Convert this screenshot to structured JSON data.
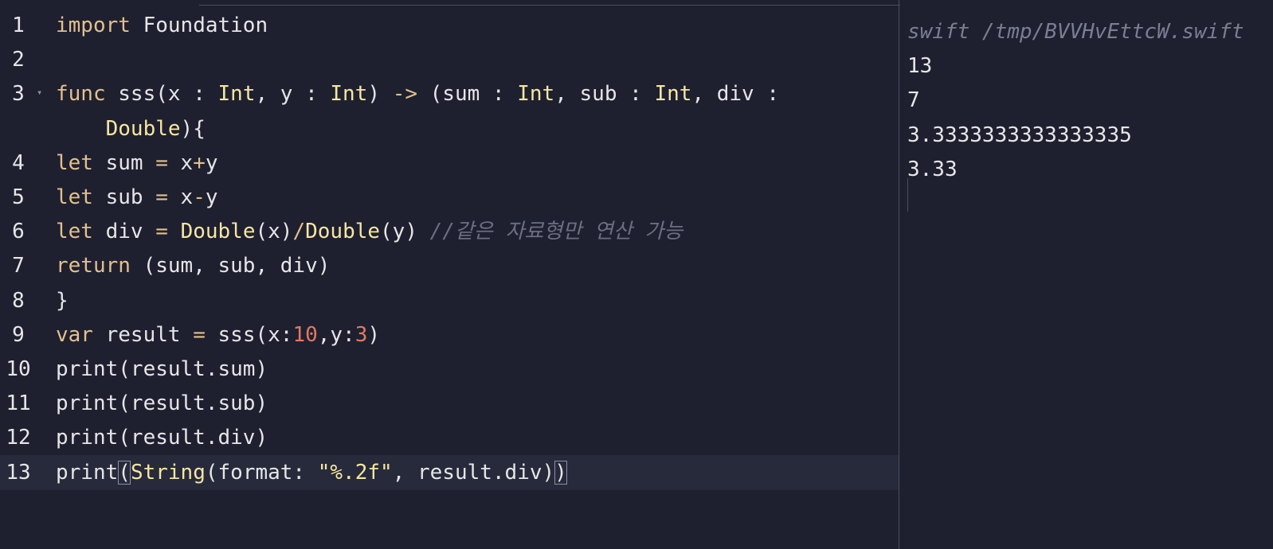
{
  "editor": {
    "lines": [
      {
        "num": "1",
        "tokens": [
          {
            "t": "import",
            "c": "kw"
          },
          {
            "t": " Foundation",
            "c": ""
          }
        ]
      },
      {
        "num": "2",
        "tokens": []
      },
      {
        "num": "3",
        "fold": true,
        "tokens": [
          {
            "t": "func",
            "c": "kw"
          },
          {
            "t": " sss(x : ",
            "c": ""
          },
          {
            "t": "Int",
            "c": "ty"
          },
          {
            "t": ", y : ",
            "c": ""
          },
          {
            "t": "Int",
            "c": "ty"
          },
          {
            "t": ") ",
            "c": ""
          },
          {
            "t": "->",
            "c": "op"
          },
          {
            "t": " (sum : ",
            "c": ""
          },
          {
            "t": "Int",
            "c": "ty"
          },
          {
            "t": ", sub : ",
            "c": ""
          },
          {
            "t": "Int",
            "c": "ty"
          },
          {
            "t": ", div :",
            "c": ""
          }
        ]
      },
      {
        "num": "",
        "tokens": [
          {
            "t": "    ",
            "c": ""
          },
          {
            "t": "Double",
            "c": "ty"
          },
          {
            "t": "){",
            "c": ""
          }
        ]
      },
      {
        "num": "4",
        "tokens": [
          {
            "t": "let",
            "c": "kw"
          },
          {
            "t": " sum ",
            "c": ""
          },
          {
            "t": "=",
            "c": "op"
          },
          {
            "t": " x",
            "c": ""
          },
          {
            "t": "+",
            "c": "op"
          },
          {
            "t": "y",
            "c": ""
          }
        ]
      },
      {
        "num": "5",
        "tokens": [
          {
            "t": "let",
            "c": "kw"
          },
          {
            "t": " sub ",
            "c": ""
          },
          {
            "t": "=",
            "c": "op"
          },
          {
            "t": " x",
            "c": ""
          },
          {
            "t": "-",
            "c": "op"
          },
          {
            "t": "y",
            "c": ""
          }
        ]
      },
      {
        "num": "6",
        "tokens": [
          {
            "t": "let",
            "c": "kw"
          },
          {
            "t": " div ",
            "c": ""
          },
          {
            "t": "=",
            "c": "op"
          },
          {
            "t": " ",
            "c": ""
          },
          {
            "t": "Double",
            "c": "ty"
          },
          {
            "t": "(x)",
            "c": ""
          },
          {
            "t": "/",
            "c": "op"
          },
          {
            "t": "Double",
            "c": "ty"
          },
          {
            "t": "(y) ",
            "c": ""
          },
          {
            "t": "//같은 자료형만 연산 가능",
            "c": "cm"
          }
        ]
      },
      {
        "num": "7",
        "tokens": [
          {
            "t": "return",
            "c": "kw"
          },
          {
            "t": " (sum, sub, div)",
            "c": ""
          }
        ]
      },
      {
        "num": "8",
        "tokens": [
          {
            "t": "}",
            "c": ""
          }
        ]
      },
      {
        "num": "9",
        "tokens": [
          {
            "t": "var",
            "c": "kw"
          },
          {
            "t": " result ",
            "c": ""
          },
          {
            "t": "=",
            "c": "op"
          },
          {
            "t": " sss(x:",
            "c": ""
          },
          {
            "t": "10",
            "c": "num"
          },
          {
            "t": ",y:",
            "c": ""
          },
          {
            "t": "3",
            "c": "num"
          },
          {
            "t": ")",
            "c": ""
          }
        ]
      },
      {
        "num": "10",
        "tokens": [
          {
            "t": "print(result.sum)",
            "c": ""
          }
        ]
      },
      {
        "num": "11",
        "tokens": [
          {
            "t": "print(result.sub)",
            "c": ""
          }
        ]
      },
      {
        "num": "12",
        "tokens": [
          {
            "t": "print(result.div)",
            "c": ""
          }
        ]
      },
      {
        "num": "13",
        "current": true,
        "tokens": [
          {
            "t": "print",
            "c": ""
          },
          {
            "t": "(",
            "c": "bracket"
          },
          {
            "t": "String",
            "c": "ty"
          },
          {
            "t": "(format: ",
            "c": ""
          },
          {
            "t": "\"%.2f\"",
            "c": "str"
          },
          {
            "t": ", result.div)",
            "c": ""
          },
          {
            "t": ")",
            "c": "bracket"
          }
        ]
      }
    ]
  },
  "output": {
    "command": "swift /tmp/BVVHvEttcW.swift",
    "lines": [
      "13",
      "7",
      "3.3333333333333335",
      "3.33"
    ]
  }
}
